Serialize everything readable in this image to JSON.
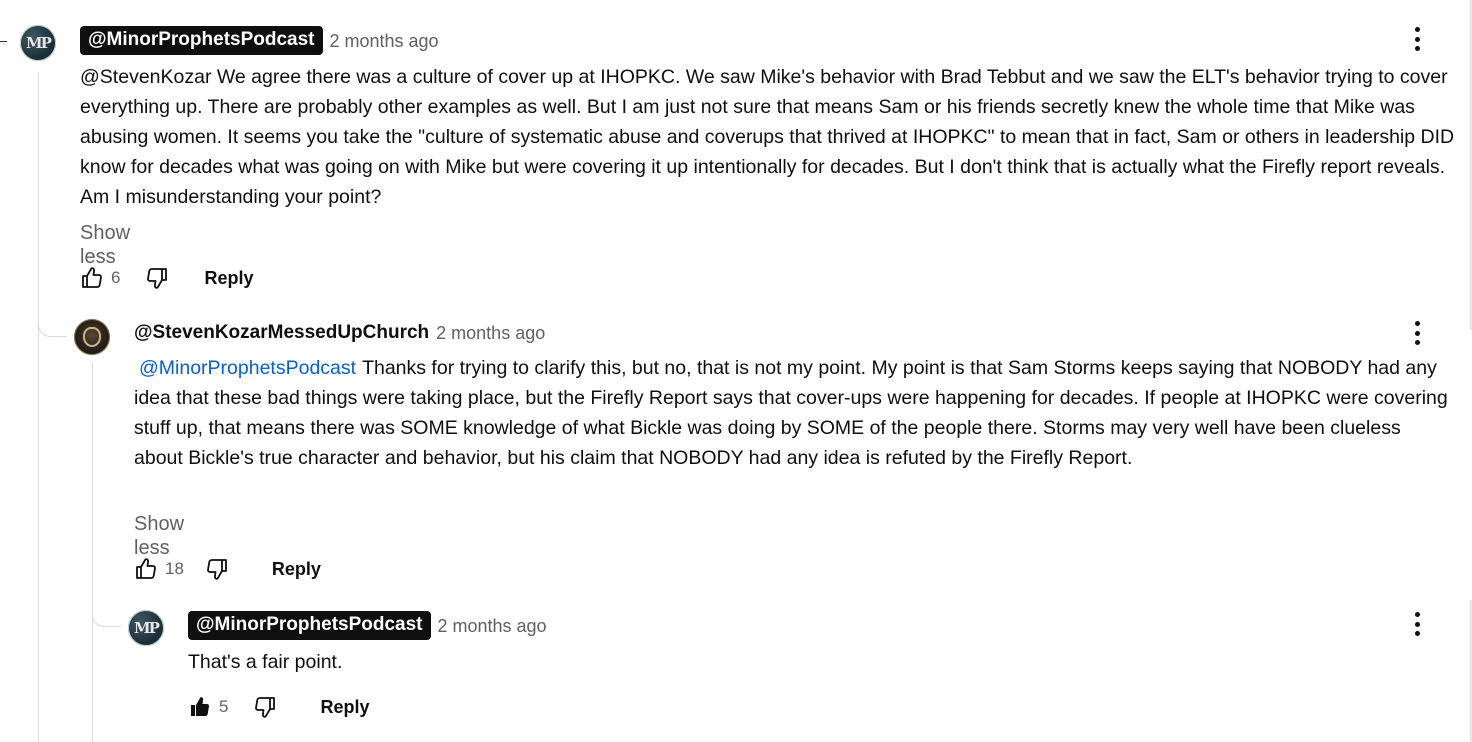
{
  "comments": [
    {
      "handle": "@MinorProphetsPodcast",
      "time": "2 months ago",
      "avatar_initials": "MP",
      "text": "@StevenKozar We agree there was a culture of cover up at IHOPKC. We saw Mike's behavior with Brad Tebbut and we saw the ELT's behavior trying to cover everything up. There are probably other examples as well. But I am just not sure that means Sam or his friends secretly knew the whole time that Mike was abusing women. It seems you take the \"culture of systematic abuse and coverups that thrived at IHOPKC\" to mean that in fact, Sam or others in leadership DID know for decades what was going on with Mike but were covering it up intentionally for decades. But I don't think that is actually what the Firefly report reveals. Am I misunderstanding your point?",
      "show_less": "Show less",
      "likes": "6",
      "reply_label": "Reply"
    },
    {
      "handle": "@StevenKozarMessedUpChurch",
      "time": "2 months ago",
      "mention": "@MinorProphetsPodcast",
      "text": "Thanks for trying to clarify this, but no, that is not my point. My point is that Sam Storms keeps saying that NOBODY had any idea that these bad things were taking place, but the Firefly Report says that cover-ups were happening for decades. If people at IHOPKC were covering stuff up, that means there was SOME knowledge of what Bickle was doing by SOME of the people there. Storms may very well have been clueless about Bickle's true character and behavior, but his claim that NOBODY had any idea is refuted by the Firefly Report.",
      "show_less": "Show less",
      "likes": "18",
      "reply_label": "Reply"
    },
    {
      "handle": "@MinorProphetsPodcast",
      "time": "2 months ago",
      "avatar_initials": "MP",
      "text": "That's a fair point.",
      "likes": "5",
      "liked": true,
      "reply_label": "Reply"
    }
  ],
  "icons": {
    "like": "thumbs-up-icon",
    "dislike": "thumbs-down-icon",
    "menu": "more-vert-icon"
  },
  "colors": {
    "mention": "#065fd4",
    "secondary_text": "#606060",
    "handle_pill_bg": "#0f0f0f"
  }
}
